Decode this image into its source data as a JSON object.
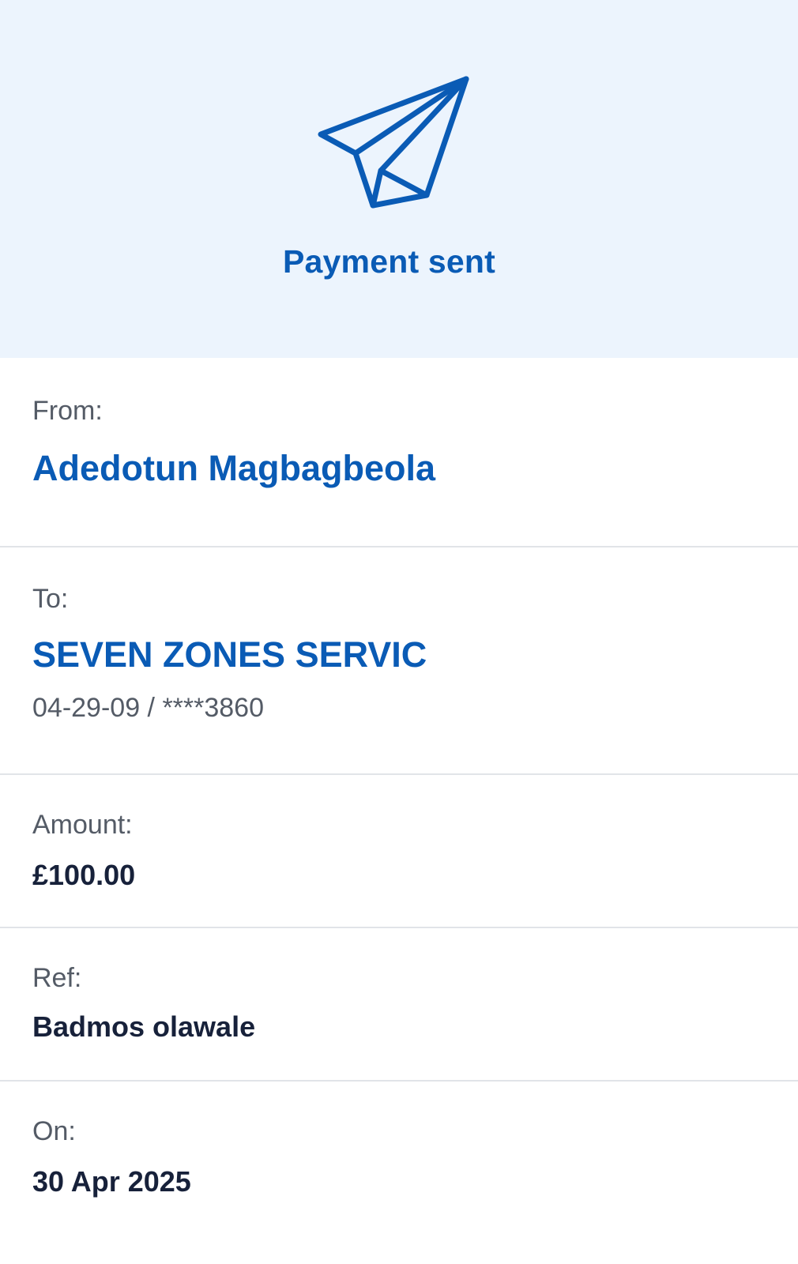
{
  "header": {
    "icon": "paper-plane-icon",
    "title": "Payment sent",
    "accent_color": "#0a5bb5",
    "background_color": "#ecf4fd"
  },
  "from": {
    "label": "From:",
    "name": "Adedotun Magbagbeola"
  },
  "to": {
    "label": "To:",
    "name": "SEVEN ZONES SERVIC",
    "account": "04-29-09 / ****3860"
  },
  "amount": {
    "label": "Amount:",
    "value": "£100.00"
  },
  "reference": {
    "label": "Ref:",
    "value": "Badmos olawale"
  },
  "date": {
    "label": "On:",
    "value": "30 Apr 2025"
  }
}
